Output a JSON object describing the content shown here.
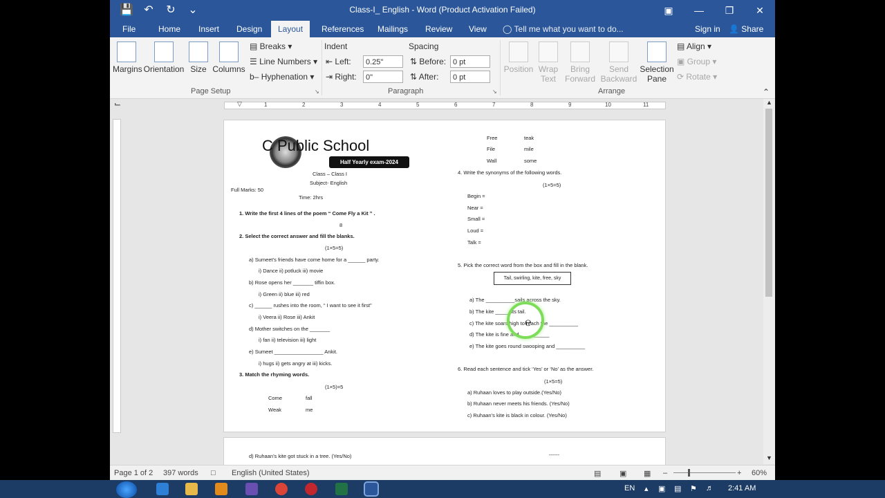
{
  "window": {
    "title": "Class-I_ English - Word (Product Activation Failed)"
  },
  "quick_access": {
    "save": "save-icon",
    "undo": "undo-icon",
    "redo": "redo-icon",
    "customize": "customize-icon"
  },
  "tabs": [
    {
      "label": "File"
    },
    {
      "label": "Home"
    },
    {
      "label": "Insert"
    },
    {
      "label": "Design"
    },
    {
      "label": "Layout"
    },
    {
      "label": "References"
    },
    {
      "label": "Mailings"
    },
    {
      "label": "Review"
    },
    {
      "label": "View"
    }
  ],
  "tellme": "Tell me what you want to do...",
  "signin": "Sign in",
  "share": "Share",
  "ribbon": {
    "page_setup": {
      "margins": "Margins",
      "orientation": "Orientation",
      "size": "Size",
      "columns": "Columns",
      "breaks": "Breaks",
      "line_numbers": "Line Numbers",
      "hyphenation": "Hyphenation",
      "label": "Page Setup"
    },
    "paragraph": {
      "indent": "Indent",
      "spacing": "Spacing",
      "left_label": "Left:",
      "left_value": "0.25\"",
      "right_label": "Right:",
      "right_value": "0\"",
      "before_label": "Before:",
      "before_value": "0 pt",
      "after_label": "After:",
      "after_value": "0 pt",
      "label": "Paragraph"
    },
    "arrange": {
      "position": "Position",
      "wrap_text_1": "Wrap",
      "wrap_text_2": "Text",
      "bring_forward_1": "Bring",
      "bring_forward_2": "Forward",
      "send_backward_1": "Send",
      "send_backward_2": "Backward",
      "selection_pane_1": "Selection",
      "selection_pane_2": "Pane",
      "align": "Align",
      "group": "Group",
      "rotate": "Rotate",
      "label": "Arrange"
    }
  },
  "ruler_numbers": [
    "1",
    "2",
    "3",
    "4",
    "5",
    "6",
    "7",
    "8",
    "9",
    "10",
    "11"
  ],
  "doc": {
    "school": "C  Public School",
    "exam": "Half Yearly exam-2024",
    "class": "Class – Class I",
    "subject": "Subject- English",
    "marks": "Full Marks: 50",
    "time": "Time: 2hrs",
    "q1": "1.   Write the first 4 lines of the poem “ Come Fly a Kit ” .",
    "q1_marks": "8",
    "q2": "2.   Select the correct answer and fill the blanks.",
    "q2_marks": "(1×5=5)",
    "q2a": "a)   Sumeet’s friends have come home for a ______ party.",
    "q2a_opt": "i)   Dance   ii) potluck        iii) movie",
    "q2b": "b)   Rose opens her _______ tiffin box.",
    "q2b_opt": "i)   Green   ii) blue             iii) red",
    "q2c": "c)   ______ rushes into the room, “ I want to  see it first”",
    "q2c_opt": "i)   Veera   ii) Rose            iii) Ankit",
    "q2d": "d)   Mother switches on the _______",
    "q2d_opt": "i) fan      ii) television     iii) light",
    "q2e": "e)   Sumeet _________________ Ankit.",
    "q2e_opt": "i)   hugs   ii) gets angry at          iii) kicks.",
    "q3": "3.   Match the rhyming words.",
    "q3_marks": "(1×5)=5",
    "m1a": "Come",
    "m1b": "fall",
    "m2a": "Weak",
    "m2b": "me",
    "m3a": "Free",
    "m3b": "teak",
    "m4a": "File",
    "m4b": "mile",
    "m5a": "Wall",
    "m5b": "some",
    "q4": "4.   Write the synonyms of the following words.",
    "q4_marks": "(1×5=5)",
    "s1": "Begin =",
    "s2": "Near =",
    "s3": "Small =",
    "s4": "Loud =",
    "s5": "Talk =",
    "q5": "5.   Pick the correct word from the box and fill in the blank.",
    "q5_box": "Tail, swirling, kite, free, sky",
    "q5a": "a)   The __________sails across the sky.",
    "q5b": "b)   The kite _____ its tail.",
    "q5c": "c)   The kite soars high to reach the __________",
    "q5d": "d)   The kite is fine and __________",
    "q5e": "e)   The kite goes round swooping and __________",
    "q6": "6.   Read each sentence and tick ‘Yes’ or ‘No’ as the answer.",
    "q6_marks": "(1×5=5)",
    "q6a": "a)   Ruhaan loves to play outside.(Yes/No)",
    "q6b": "b)   Ruhaan never meets his friends. (Yes/No)",
    "q6c": "c)   Ruhaan’s kite is black in colour. (Yes/No)",
    "q6d": "d)   Ruhaan’s kite got stuck in a tree. (Yes/No)",
    "end": "------"
  },
  "status": {
    "page": "Page 1 of 2",
    "words": "397 words",
    "language": "English (United States)",
    "zoom": "60%"
  },
  "tray": {
    "lang": "EN",
    "time": "2:41 AM"
  }
}
